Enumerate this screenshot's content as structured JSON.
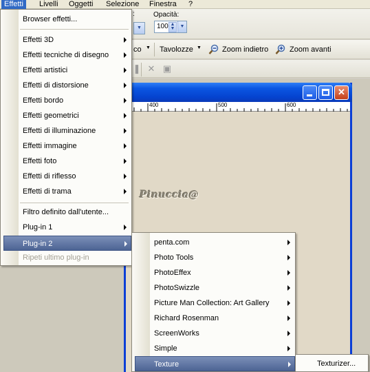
{
  "menubar": {
    "items": [
      "Effetti",
      "Livelli",
      "Oggetti",
      "Selezione",
      "Finestra",
      "?"
    ]
  },
  "options": {
    "opacity_label": "Opacità:",
    "opacity_value": "100"
  },
  "toolbar": {
    "partial_label": "co",
    "tavolozze": "Tavolozze",
    "zoom_out": "Zoom indietro",
    "zoom_in": "Zoom avanti"
  },
  "ruler": {
    "labels": [
      "400",
      "500",
      "600"
    ]
  },
  "canvas": {
    "watermark": "Pinuccia"
  },
  "effects_menu": {
    "items": [
      {
        "label": "Browser effetti...",
        "submenu": false
      },
      {
        "label": "Effetti 3D",
        "submenu": true
      },
      {
        "label": "Effetti tecniche di disegno",
        "submenu": true
      },
      {
        "label": "Effetti artistici",
        "submenu": true
      },
      {
        "label": "Effetti di distorsione",
        "submenu": true
      },
      {
        "label": "Effetti bordo",
        "submenu": true
      },
      {
        "label": "Effetti geometrici",
        "submenu": true
      },
      {
        "label": "Effetti di illuminazione",
        "submenu": true
      },
      {
        "label": "Effetti immagine",
        "submenu": true
      },
      {
        "label": "Effetti foto",
        "submenu": true
      },
      {
        "label": "Effetti di riflesso",
        "submenu": true
      },
      {
        "label": "Effetti di trama",
        "submenu": true
      },
      {
        "label": "Filtro definito dall'utente...",
        "submenu": false
      },
      {
        "label": "Plug-in 1",
        "submenu": true
      },
      {
        "label": "Plug-in 2",
        "submenu": true,
        "highlighted": true
      },
      {
        "label": "Ripeti ultimo plug-in",
        "submenu": false,
        "disabled": true
      }
    ]
  },
  "plugin2_menu": {
    "items": [
      {
        "label": "penta.com"
      },
      {
        "label": "Photo Tools"
      },
      {
        "label": "PhotoEffex"
      },
      {
        "label": "PhotoSwizzle"
      },
      {
        "label": "Picture Man Collection: Art Gallery"
      },
      {
        "label": "Richard Rosenman"
      },
      {
        "label": "ScreenWorks"
      },
      {
        "label": "Simple"
      },
      {
        "label": "Texture",
        "highlighted": true
      }
    ]
  },
  "texture_menu": {
    "items": [
      {
        "label": "Texturizer..."
      }
    ]
  },
  "colors": {
    "menu_highlight": "#4d6494",
    "titlebar": "#0b56e2",
    "menubar_active": "#316ac5"
  }
}
